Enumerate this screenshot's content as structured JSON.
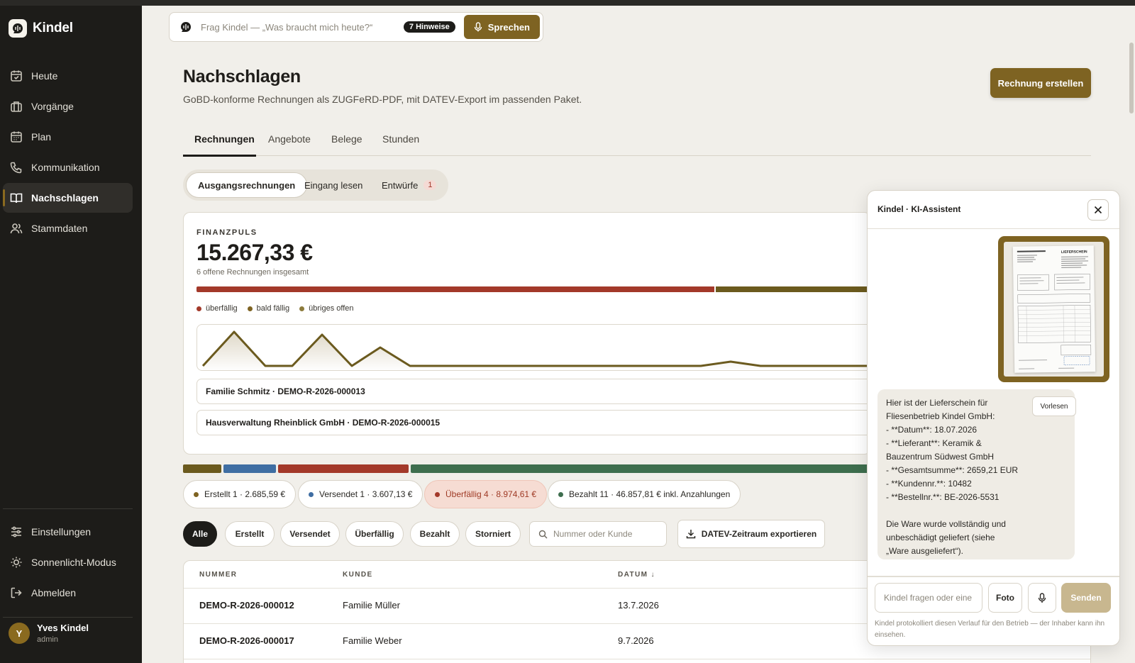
{
  "app": {
    "name": "Kindel"
  },
  "sidebar": {
    "items": [
      {
        "label": "Heute",
        "icon": "calendar-check-icon"
      },
      {
        "label": "Vorgänge",
        "icon": "briefcase-icon"
      },
      {
        "label": "Plan",
        "icon": "calendar-icon"
      },
      {
        "label": "Kommunikation",
        "icon": "phone-icon"
      },
      {
        "label": "Nachschlagen",
        "icon": "book-icon",
        "active": true
      },
      {
        "label": "Stammdaten",
        "icon": "users-icon"
      }
    ],
    "bottom": [
      {
        "label": "Einstellungen",
        "icon": "sliders-icon"
      },
      {
        "label": "Sonnenlicht-Modus",
        "icon": "sun-icon"
      },
      {
        "label": "Abmelden",
        "icon": "logout-icon"
      }
    ],
    "user": {
      "initial": "Y",
      "name": "Yves Kindel",
      "role": "admin"
    }
  },
  "search": {
    "placeholder": "Frag Kindel — „Was braucht mich heute?“",
    "hints": "7 Hinweise",
    "speak": "Sprechen"
  },
  "header": {
    "title": "Nachschlagen",
    "subtitle": "GoBD-konforme Rechnungen als ZUGFeRD-PDF, mit DATEV-Export im passenden Paket.",
    "primary_action": "Rechnung erstellen"
  },
  "tabs": [
    "Rechnungen",
    "Angebote",
    "Belege",
    "Stunden"
  ],
  "subtabs": {
    "outgoing": "Ausgangsrechnungen",
    "incoming": "Eingang lesen",
    "drafts": "Entwürfe",
    "drafts_count": "1"
  },
  "finance": {
    "label": "FINANZPULS",
    "amount": "15.267,33 €",
    "sub": "6 offene Rechnungen insgesamt",
    "legend": [
      "überfällig",
      "bald fällig",
      "übriges offen"
    ],
    "rows": [
      "Familie Schmitz · DEMO-R-2026-000013",
      "Hausverwaltung Rheinblick GmbH · DEMO-R-2026-000015"
    ]
  },
  "status_chips": [
    {
      "label": "Erstellt 1 · 2.685,59 €",
      "color": "#7e6322"
    },
    {
      "label": "Versendet 1 · 3.607,13 €",
      "color": "#3f6ea3"
    },
    {
      "label": "Überfällig 4 · 8.974,61 €",
      "color": "#a3392a"
    },
    {
      "label": "Bezahlt 11 · 46.857,81 € inkl. Anzahlungen",
      "color": "#3e6e4e"
    }
  ],
  "filters": [
    "Alle",
    "Erstellt",
    "Versendet",
    "Überfällig",
    "Bezahlt",
    "Storniert"
  ],
  "filter_search_placeholder": "Nummer oder Kunde",
  "export_label": "DATEV-Zeitraum exportieren",
  "table": {
    "headers": [
      "NUMMER",
      "KUNDE",
      "DATUM ↓"
    ],
    "rows": [
      {
        "nummer": "DEMO-R-2026-000012",
        "kunde": "Familie Müller",
        "datum": "13.7.2026"
      },
      {
        "nummer": "DEMO-R-2026-000017",
        "kunde": "Familie Weber",
        "datum": "9.7.2026"
      }
    ]
  },
  "assistant": {
    "title": "Kindel · KI-Assistent",
    "message_lines": [
      "Hier ist der Lieferschein für",
      "Fliesenbetrieb Kindel GmbH:",
      "- **Datum**: 18.07.2026",
      "- **Lieferant**: Keramik &",
      "Bauzentrum Südwest GmbH",
      "- **Gesamtsumme**: 2659,21 EUR",
      "- **Kundennr.**: 10482",
      "- **Bestellnr.**: BE-2026-5531",
      "",
      "Die Ware wurde vollständig und",
      "unbeschädigt geliefert (siehe",
      "„Ware ausgeliefert“)."
    ],
    "read_aloud": "Vorlesen",
    "input_placeholder": "Kindel fragen oder eine",
    "photo": "Foto",
    "send": "Senden",
    "footer": "Kindel protokolliert diesen Verlauf für den Betrieb — der Inhaber kann ihn einsehen.",
    "doc_heading": "LIEFERSCHEIN"
  },
  "colors": {
    "accent": "#7e6322",
    "danger": "#a3392a",
    "blue": "#3f6ea3",
    "green": "#3e6e4e",
    "sidebar": "#1d1c19"
  }
}
